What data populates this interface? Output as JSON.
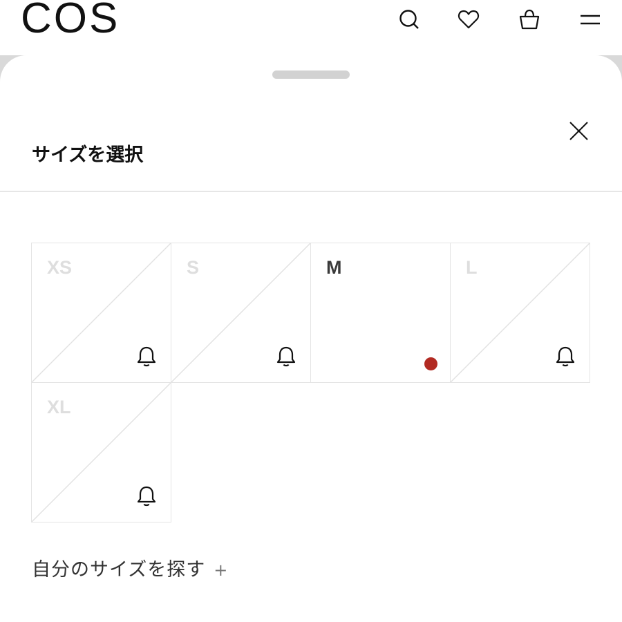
{
  "header": {
    "logo": "COS",
    "icons": [
      "search-icon",
      "heart-icon",
      "bag-icon",
      "menu-icon"
    ]
  },
  "sheet": {
    "title": "サイズを選択",
    "sizes": [
      {
        "label": "XS",
        "available": false,
        "icon": "bell-icon"
      },
      {
        "label": "S",
        "available": false,
        "icon": "bell-icon"
      },
      {
        "label": "M",
        "available": true,
        "icon": "low-stock-dot"
      },
      {
        "label": "L",
        "available": false,
        "icon": "bell-icon"
      },
      {
        "label": "XL",
        "available": false,
        "icon": "bell-icon"
      }
    ],
    "find_size_label": "自分のサイズを探す",
    "find_size_plus": "+"
  },
  "colors": {
    "low_stock": "#b22a22",
    "unavailable_text": "#dedede",
    "tile_border": "#e4e4e4",
    "backdrop": "#d9d9d9"
  }
}
